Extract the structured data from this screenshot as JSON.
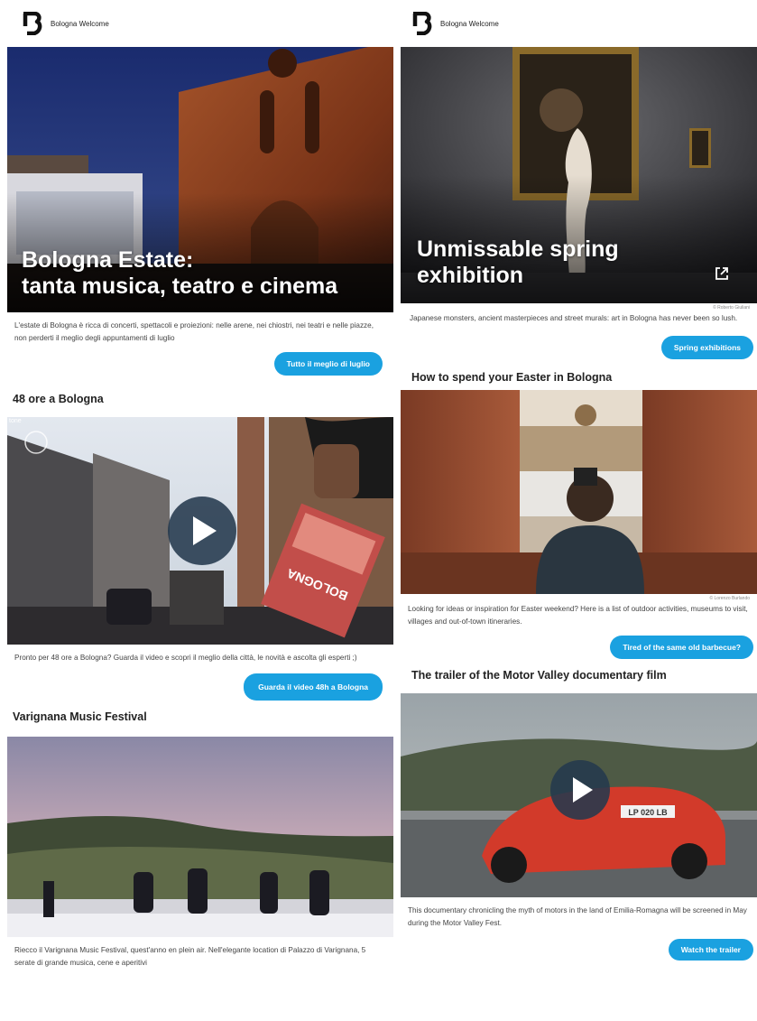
{
  "left": {
    "brand": "Bologna Welcome",
    "hero": {
      "title_line1": "Bologna Estate:",
      "title_line2": "tanta musica, teatro e cinema"
    },
    "hero_desc": "L'estate di Bologna è ricca di concerti, spettacoli e proiezioni: nelle arene, nei chiostri, nei teatri e nelle piazze, non perderti il meglio degli appuntamenti di luglio",
    "hero_button": "Tutto il meglio di luglio",
    "section2": {
      "title": "48 ore a Bologna",
      "badge": "tone",
      "desc": "Pronto per 48 ore a Bologna? Guarda il video e scopri il meglio della città, le novità e ascolta gli esperti ;)",
      "button": "Guarda il video 48h a Bologna",
      "brochure_text": "BOLOGNA"
    },
    "section3": {
      "title": "Varignana Music Festival",
      "desc": "Riecco il Varignana Music Festival, quest'anno en plein air. Nell'elegante location di Palazzo di Varignana, 5 serate di grande musica, cene e aperitivi"
    }
  },
  "right": {
    "brand": "Bologna Welcome",
    "hero": {
      "title_line1": "Unmissable spring",
      "title_line2": "exhibition",
      "credit": "© Roberto Giuliani"
    },
    "hero_desc": "Japanese monsters, ancient masterpieces and street murals: art in Bologna has never been so lush.",
    "hero_button": "Spring exhibitions",
    "section2": {
      "title": "How to spend your Easter in Bologna",
      "credit": "© Lorenzo Burlando",
      "desc": "Looking for ideas or inspiration for Easter weekend? Here is a list of outdoor activities, museums to visit, villages and out-of-town itineraries.",
      "button": "Tired of the same old barbecue?"
    },
    "section3": {
      "title": "The trailer of the Motor Valley documentary film",
      "plate": "LP 020 LB",
      "desc": "This documentary chronicling the myth of motors in the land of Emilia-Romagna will be screened in May during the Motor Valley Fest.",
      "button": "Watch the trailer"
    }
  },
  "colors": {
    "button": "#1aa1e0",
    "play": "#24394d",
    "text": "#222222"
  },
  "icons": [
    "bologna-logo-icon",
    "external-link-icon",
    "play-icon"
  ]
}
